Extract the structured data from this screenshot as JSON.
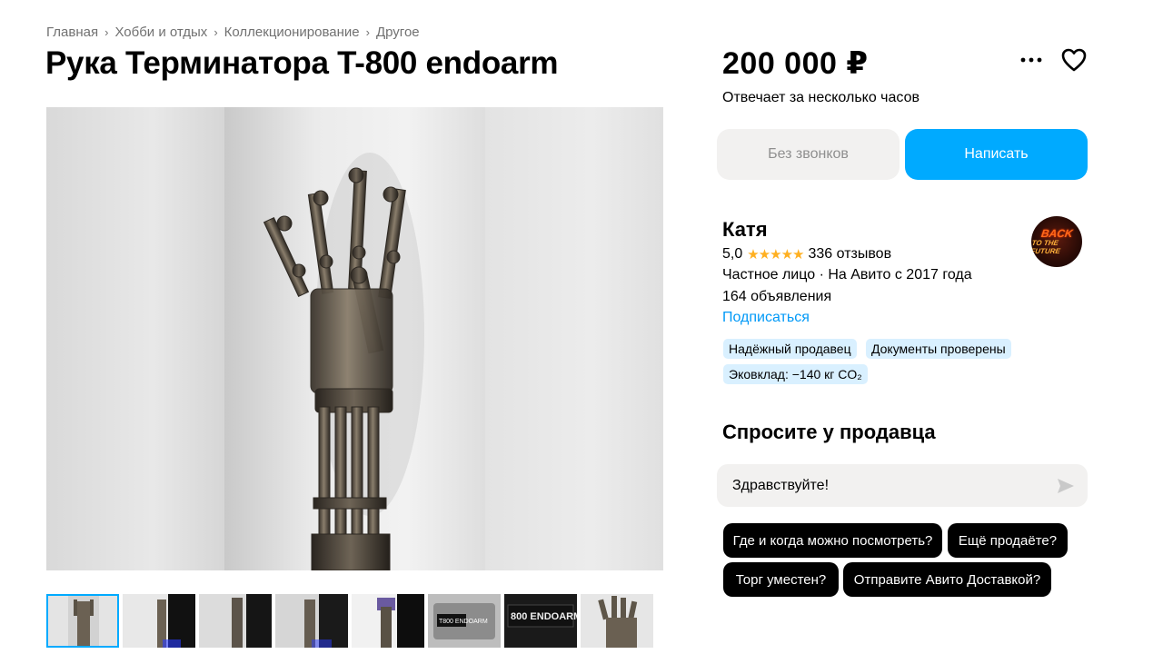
{
  "breadcrumb": {
    "items": [
      {
        "label": "Главная"
      },
      {
        "label": "Хобби и отдых"
      },
      {
        "label": "Коллекционирование"
      },
      {
        "label": "Другое"
      }
    ],
    "separator": "›"
  },
  "listing": {
    "title": "Рука Терминатора T-800 endoarm",
    "price": "200 000 ₽",
    "response_time": "Отвечает за несколько часов"
  },
  "actions": {
    "more_icon": "more-horizontal-icon",
    "favorite_icon": "heart-icon",
    "no_calls_label": "Без звонков",
    "write_label": "Написать"
  },
  "seller": {
    "name": "Катя",
    "rating": "5,0",
    "stars": "★★★★★",
    "reviews": "336 отзывов",
    "type_since": "Частное лицо · На Авито с 2017 года",
    "ads_count": "164 объявления",
    "subscribe_label": "Подписаться",
    "avatar_text_1": "BACK",
    "avatar_text_2": "TO THE FUTURE",
    "badges": [
      "Надёжный продавец",
      "Документы проверены",
      "Эковклад: −140 кг CO₂"
    ]
  },
  "ask": {
    "title": "Спросите у продавца",
    "input_value": "Здравствуйте!",
    "send_icon": "send-icon",
    "quick_questions": [
      "Где и когда можно посмотреть?",
      "Ещё продаёте?",
      "Торг уместен?",
      "Отправите Авито Доставкой?"
    ]
  },
  "gallery": {
    "thumbnail_count": 8,
    "selected_index": 0,
    "thumb_texts": [
      "T800 ENDOARM",
      "800 ENDOARM"
    ]
  },
  "colors": {
    "accent": "#00aaff",
    "link": "#0099f7",
    "star": "#ffb021",
    "badge_bg": "#d9f0ff",
    "chip_bg": "#000000"
  }
}
